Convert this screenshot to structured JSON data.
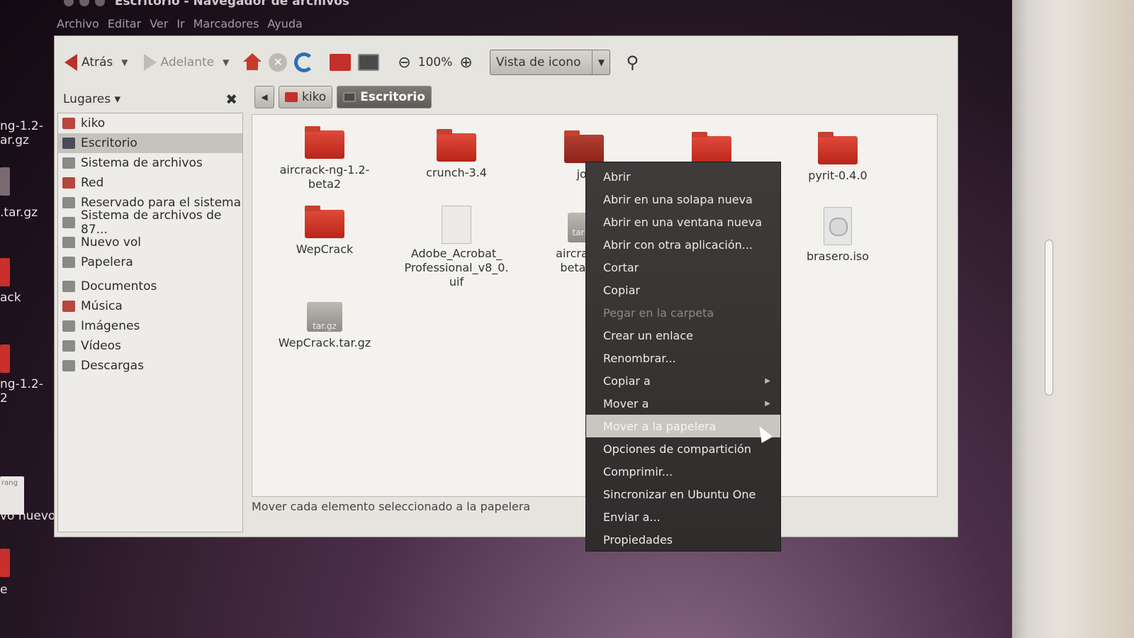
{
  "window": {
    "title": "Escritorio - Navegador de archivos"
  },
  "menubar": [
    "Archivo",
    "Editar",
    "Ver",
    "Ir",
    "Marcadores",
    "Ayuda"
  ],
  "toolbar": {
    "back": "Atrás",
    "forward": "Adelante",
    "zoom": "100%",
    "view_mode": "Vista de icono"
  },
  "sidebar": {
    "header": "Lugares ▾",
    "places": [
      {
        "label": "kiko"
      },
      {
        "label": "Escritorio"
      },
      {
        "label": "Sistema de archivos"
      },
      {
        "label": "Red"
      },
      {
        "label": "Reservado para el sistema"
      },
      {
        "label": "Sistema de archivos de 87..."
      },
      {
        "label": "Nuevo vol"
      },
      {
        "label": "Papelera"
      }
    ],
    "bookmarks": [
      {
        "label": "Documentos"
      },
      {
        "label": "Música"
      },
      {
        "label": "Imágenes"
      },
      {
        "label": "Vídeos"
      },
      {
        "label": "Descargas"
      }
    ]
  },
  "pathbar": {
    "parent": "kiko",
    "current": "Escritorio"
  },
  "files": [
    {
      "label": "aircrack-ng-1.2-\nbeta2",
      "icon": "folder-icon"
    },
    {
      "label": "crunch-3.4",
      "icon": "folder-icon"
    },
    {
      "label": "jor",
      "icon": "folder-icon"
    },
    {
      "label": "",
      "icon": "folder-icon"
    },
    {
      "label": "pyrit-0.4.0",
      "icon": "folder-icon"
    },
    {
      "label": "WepCrack",
      "icon": "folder-icon"
    },
    {
      "label": "Adobe_Acrobat_\nProfessional_v8_0.\nuif",
      "icon": "document-icon"
    },
    {
      "label": "aircrack\nbeta2.",
      "icon": "archive-icon"
    },
    {
      "label": "brasero.iso",
      "icon": "disc-image-icon"
    },
    {
      "label": "WepCrack.tar.gz",
      "icon": "archive-icon"
    }
  ],
  "archive_badge": "tar.gz",
  "archive_badge_short": "tar",
  "status": "Mover cada elemento seleccionado a la papelera",
  "context_menu": [
    {
      "label": "Abrir"
    },
    {
      "label": "Abrir en una solapa nueva"
    },
    {
      "label": "Abrir en una ventana nueva"
    },
    {
      "label": "Abrir con otra aplicación..."
    },
    {
      "label": "Cortar"
    },
    {
      "label": "Copiar"
    },
    {
      "label": "Pegar en la carpeta"
    },
    {
      "label": "Crear un enlace"
    },
    {
      "label": "Renombrar..."
    },
    {
      "label": "Copiar a"
    },
    {
      "label": "Mover a"
    },
    {
      "label": "Mover a la papelera"
    },
    {
      "label": "Opciones de compartición"
    },
    {
      "label": "Comprimir..."
    },
    {
      "label": "Sincronizar en Ubuntu One"
    },
    {
      "label": "Enviar a..."
    },
    {
      "label": "Propiedades"
    }
  ],
  "desktop": {
    "fragments": [
      "ng-1.2-",
      "ar.gz",
      ".tar.gz",
      "ack",
      "ng-1.2-",
      "2",
      "vo nuevo",
      "e"
    ],
    "doc_badge": "rang"
  },
  "colors": {
    "accent": "#c4302a",
    "menu_bg": "#3a3736",
    "highlight": "#c9c5c0"
  }
}
